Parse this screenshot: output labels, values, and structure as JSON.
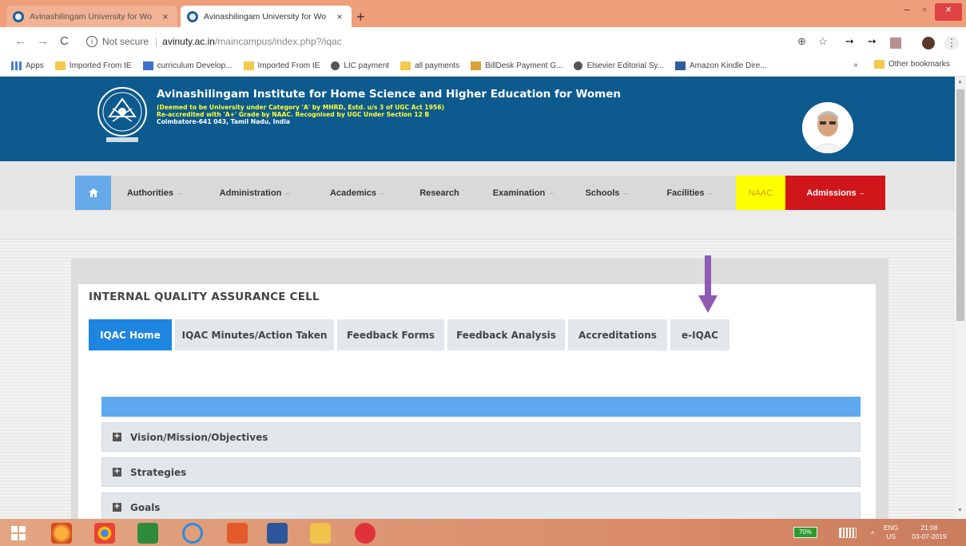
{
  "browser": {
    "tabs": [
      {
        "title": "Avinashilingam University for Wo",
        "close": "×"
      },
      {
        "title": "Avinashilingam University for Wo",
        "close": "×"
      }
    ],
    "new_tab": "+",
    "controls": {
      "minimize": "–",
      "maximize": "▫",
      "close": "×"
    },
    "nav": {
      "back": "←",
      "forward": "→",
      "reload": "C"
    },
    "address": {
      "info_icon": "i",
      "security": "Not secure",
      "separator": "|",
      "host": "avinuty.ac.in",
      "path": "/maincampus/index.php?/iqac"
    },
    "addr_icons": {
      "zoom": "⊕",
      "star": "☆",
      "arrow": "➙",
      "menu": "⋮"
    },
    "bookmarks": [
      {
        "icon": "apps-icon",
        "label": "Apps"
      },
      {
        "icon": "folder-icon",
        "label": "Imported From IE"
      },
      {
        "icon": "s-icon",
        "label": "curriculum Develop..."
      },
      {
        "icon": "folder-icon",
        "label": "Imported From IE"
      },
      {
        "icon": "globe-icon",
        "label": "LIC payment"
      },
      {
        "icon": "folder-icon",
        "label": "all payments"
      },
      {
        "icon": "card-icon",
        "label": "BillDesk Payment G..."
      },
      {
        "icon": "globe-icon",
        "label": "Elsevier Editorial Sy..."
      },
      {
        "icon": "kindle-icon",
        "label": "Amazon Kindle Dire..."
      }
    ],
    "bookmarks_more": "»",
    "other_bookmarks": "Other bookmarks"
  },
  "header": {
    "title": "Avinashilingam Institute for Home Science and Higher Education for Women",
    "line1": "(Deemed to be University under Category 'A' by MHRD, Estd. u/s 3 of UGC Act 1956)",
    "line2": "Re-accredited with 'A+' Grade by NAAC. Recognised by UGC Under Section 12 B",
    "line3": "Coimbatore-641 043, Tamil Nadu, India"
  },
  "nav": {
    "items": [
      {
        "label": "Authorities",
        "caret": "–"
      },
      {
        "label": "Administration",
        "caret": "–"
      },
      {
        "label": "Academics",
        "caret": "–"
      },
      {
        "label": "Research",
        "caret": ""
      },
      {
        "label": "Examination",
        "caret": "–"
      },
      {
        "label": "Schools",
        "caret": "–"
      },
      {
        "label": "Facilities",
        "caret": "–"
      },
      {
        "label": "NAAC",
        "caret": ""
      },
      {
        "label": "Admissions",
        "caret": "–"
      }
    ],
    "colors": {
      "home": "#66a9e8",
      "naac": "#ffff00",
      "admissions": "#d0151b"
    }
  },
  "main": {
    "title": "INTERNAL QUALITY ASSURANCE CELL",
    "tabs": [
      {
        "label": "IQAC Home"
      },
      {
        "label": "IQAC Minutes/Action Taken"
      },
      {
        "label": "Feedback Forms"
      },
      {
        "label": "Feedback Analysis"
      },
      {
        "label": "Accreditations"
      },
      {
        "label": "e-IQAC"
      }
    ],
    "active_tab": "IQAC Home",
    "accordion": [
      {
        "label": "Vision/Mission/Objectives",
        "toggle": "+"
      },
      {
        "label": "Strategies",
        "toggle": "+"
      },
      {
        "label": "Goals",
        "toggle": "+"
      }
    ],
    "accent_color": "#1e85e0"
  },
  "taskbar": {
    "battery": "70%",
    "lang": {
      "line1": "ENG",
      "line2": "US"
    },
    "clock": {
      "time": "21:08",
      "date": "03-07-2019"
    },
    "tray_caret": "^"
  }
}
